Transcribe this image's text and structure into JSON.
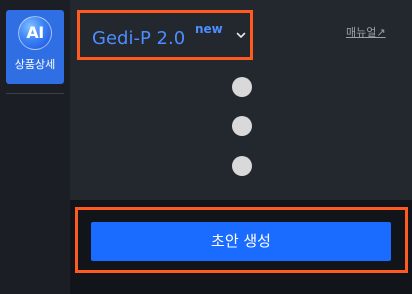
{
  "sidebar": {
    "ai_badge_text": "AI",
    "product_detail_label": "상품상세"
  },
  "header": {
    "model_name": "Gedi-P 2.0",
    "model_badge": "new",
    "chevron_icon": "chevron-down-icon",
    "manual_link": "매뉴얼↗"
  },
  "actions": {
    "more_icon": "kebab-vertical-icon",
    "generate_draft_label": "초안 생성"
  },
  "colors": {
    "accent_blue": "#1a6bff",
    "model_text": "#4d8dff",
    "highlight_orange": "#ff5a1f",
    "panel_bg": "#23272e",
    "sidebar_bg": "#1b1e24"
  }
}
